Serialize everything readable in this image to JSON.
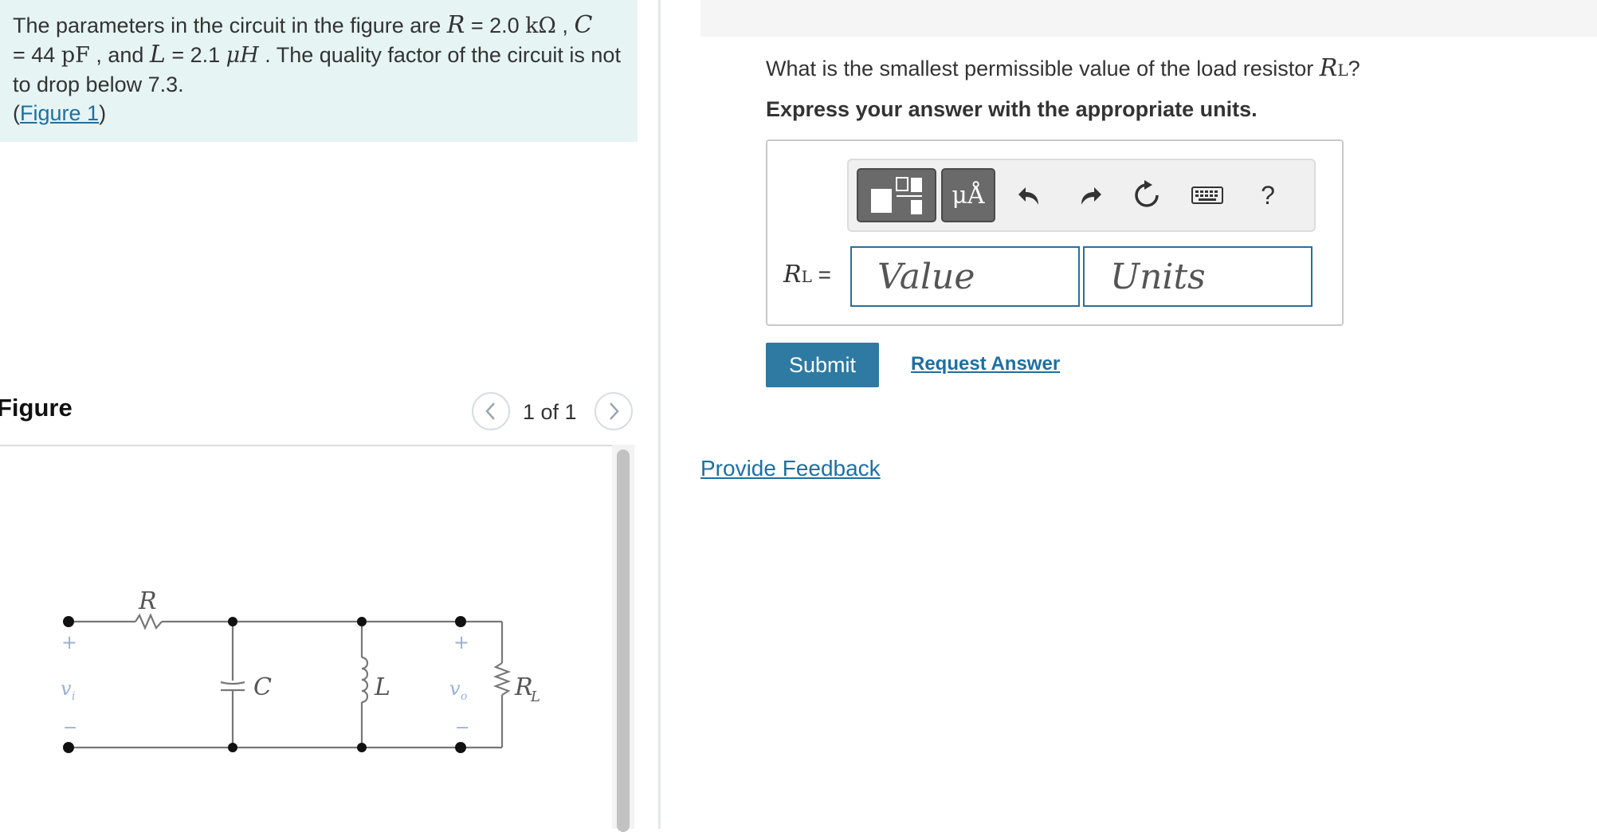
{
  "problem": {
    "text_1": "The parameters in the circuit in the figure are ",
    "r_symbol": "R",
    "r_eq": " = 2.0 ",
    "r_unit": "kΩ",
    "sep_c": " , ",
    "c_symbol": "C",
    "c_eq": "= 44 ",
    "c_unit": "pF",
    "text_and": " , and ",
    "l_symbol": "L",
    "l_eq": " = 2.1 ",
    "l_unit": "μH",
    "text_2": " . The quality factor of the circuit is not to drop below 7.3.",
    "figure_link": "Figure 1",
    "paren_open": "(",
    "paren_close": ")"
  },
  "figure": {
    "title": "Figure",
    "page_indicator": "1 of 1",
    "labels": {
      "R": "R",
      "C": "C",
      "L": "L",
      "RL_main": "R",
      "RL_sub": "L",
      "vi_main": "v",
      "vi_sub": "i",
      "vo_main": "v",
      "vo_sub": "o",
      "plus": "+",
      "minus": "−"
    }
  },
  "question": {
    "text": "What is the smallest permissible value of the load resistor ",
    "symbol_main": "R",
    "symbol_sub": "L",
    "end": "?",
    "instruction": "Express your answer with the appropriate units."
  },
  "answer": {
    "label_main": "R",
    "label_sub": "L",
    "label_eq": " =",
    "value_placeholder": "Value",
    "units_placeholder": "Units"
  },
  "toolbar": {
    "units_button_label": "μÅ",
    "help_label": "?"
  },
  "actions": {
    "submit_label": "Submit",
    "request_answer_label": "Request Answer",
    "feedback_label": "Provide Feedback"
  },
  "colors": {
    "problem_bg": "#e6f4f4",
    "link": "#1f6fa1",
    "submit_bg": "#2e7aa3",
    "input_border": "#2b6e9d"
  },
  "icons": {
    "templates": "fraction-template-icon",
    "units": "units-icon",
    "undo": "undo-icon",
    "redo": "redo-icon",
    "reset": "reset-icon",
    "keyboard": "keyboard-icon",
    "help": "help-icon",
    "prev": "chevron-left-icon",
    "next": "chevron-right-icon"
  }
}
